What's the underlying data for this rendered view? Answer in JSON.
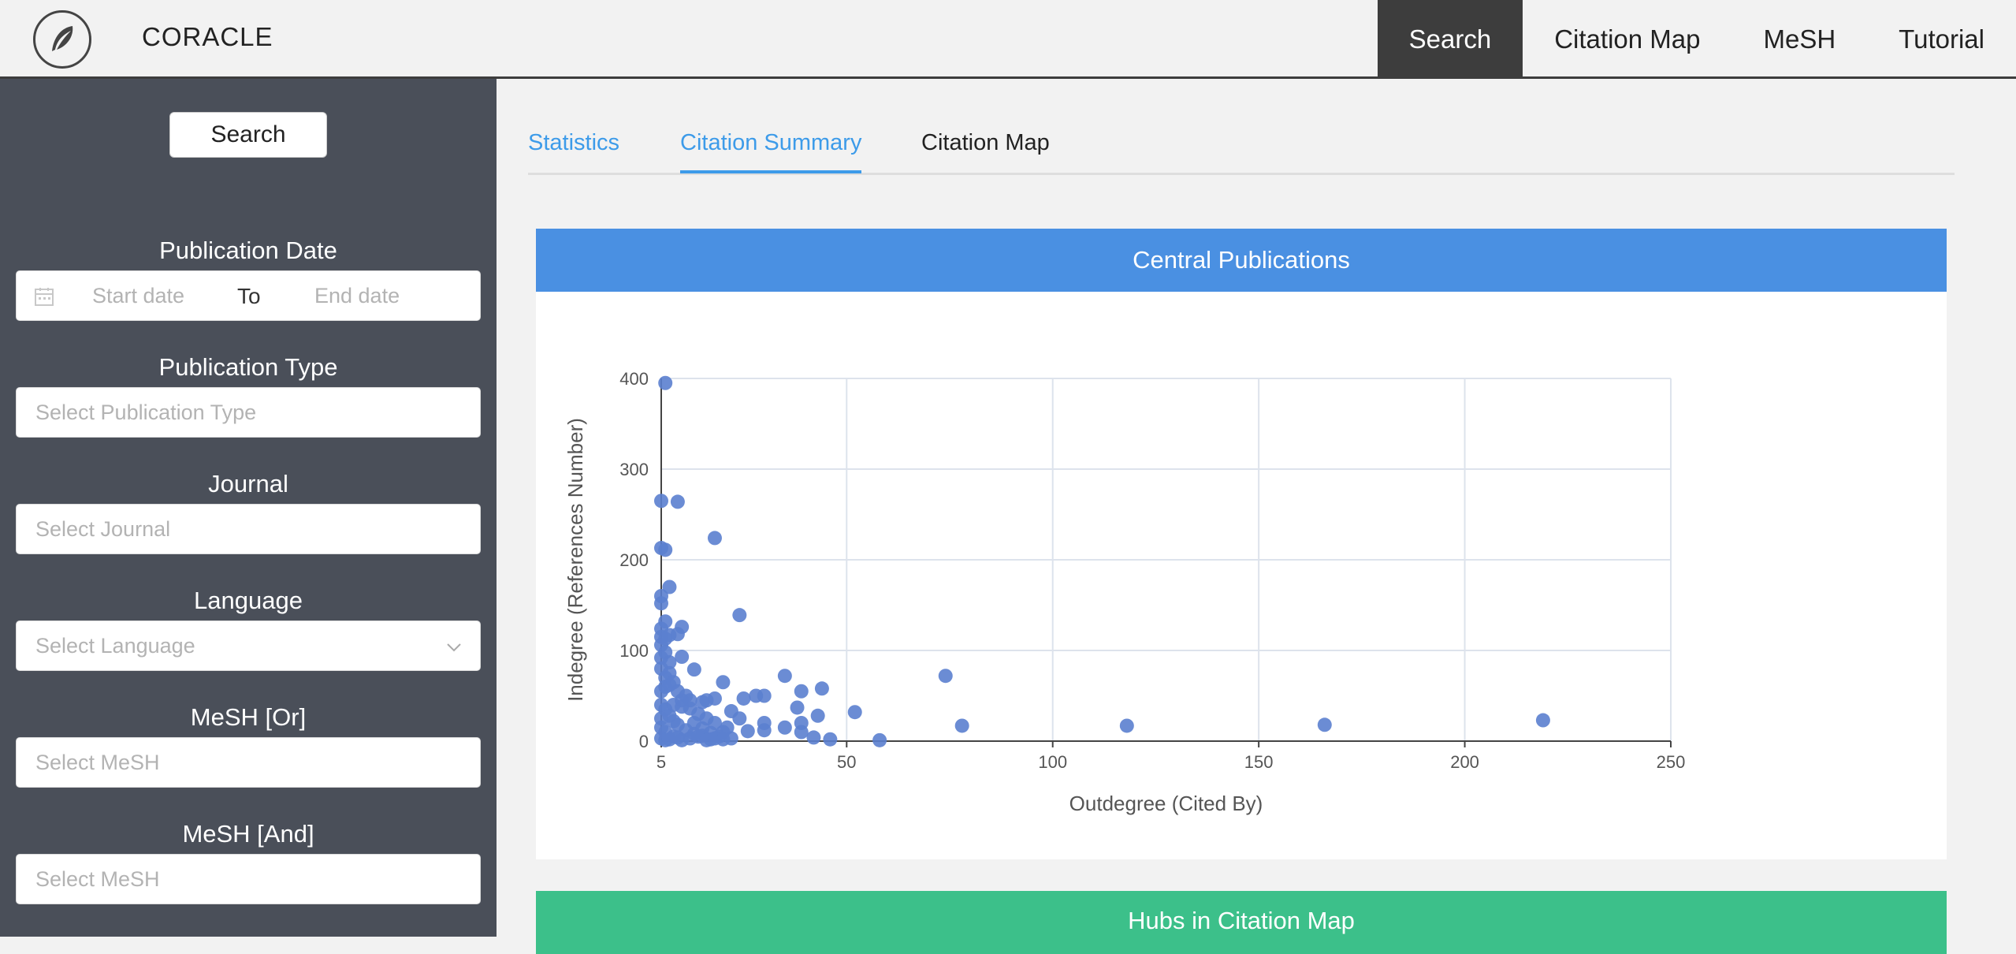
{
  "app": {
    "brand": "CORACLE"
  },
  "nav": {
    "items": [
      {
        "label": "Search",
        "active": true
      },
      {
        "label": "Citation Map",
        "active": false
      },
      {
        "label": "MeSH",
        "active": false
      },
      {
        "label": "Tutorial",
        "active": false
      }
    ]
  },
  "sidebar": {
    "search_label": "Search",
    "publication_date": {
      "label": "Publication Date",
      "start_placeholder": "Start date",
      "to": "To",
      "end_placeholder": "End date"
    },
    "publication_type": {
      "label": "Publication Type",
      "placeholder": "Select Publication Type"
    },
    "journal": {
      "label": "Journal",
      "placeholder": "Select Journal"
    },
    "language": {
      "label": "Language",
      "placeholder": "Select Language"
    },
    "mesh_or": {
      "label": "MeSH [Or]",
      "placeholder": "Select MeSH"
    },
    "mesh_and": {
      "label": "MeSH [And]",
      "placeholder": "Select MeSH"
    }
  },
  "tabs": [
    {
      "label": "Statistics"
    },
    {
      "label": "Citation Summary",
      "active": true
    },
    {
      "label": "Citation Map"
    }
  ],
  "cards": {
    "central": {
      "title": "Central Publications"
    },
    "hubs": {
      "title": "Hubs in Citation Map"
    }
  },
  "colors": {
    "accent": "#3d9be9",
    "card_header": "#4a90e2",
    "hubs_header": "#3cc08a",
    "point": "#5b7fcf",
    "sidebar": "#4a4f59"
  },
  "chart_data": {
    "type": "scatter",
    "xlabel": "Outdegree (Cited By)",
    "ylabel": "Indegree (References Number)",
    "xlim": [
      5,
      250
    ],
    "ylim": [
      0,
      400
    ],
    "xticks": [
      5,
      50,
      100,
      150,
      200,
      250
    ],
    "yticks": [
      0,
      100,
      200,
      300,
      400
    ],
    "grid": true,
    "points": [
      [
        6,
        395
      ],
      [
        5,
        265
      ],
      [
        9,
        264
      ],
      [
        5,
        213
      ],
      [
        6,
        211
      ],
      [
        18,
        224
      ],
      [
        7,
        170
      ],
      [
        5,
        160
      ],
      [
        5,
        152
      ],
      [
        24,
        139
      ],
      [
        6,
        132
      ],
      [
        10,
        126
      ],
      [
        5,
        124
      ],
      [
        9,
        118
      ],
      [
        7,
        117
      ],
      [
        5,
        115
      ],
      [
        6,
        113
      ],
      [
        5,
        106
      ],
      [
        10,
        93
      ],
      [
        6,
        98
      ],
      [
        5,
        92
      ],
      [
        7,
        87
      ],
      [
        13,
        79
      ],
      [
        74,
        72
      ],
      [
        35,
        72
      ],
      [
        20,
        65
      ],
      [
        44,
        58
      ],
      [
        39,
        55
      ],
      [
        28,
        50
      ],
      [
        30,
        50
      ],
      [
        25,
        47
      ],
      [
        18,
        47
      ],
      [
        16,
        45
      ],
      [
        15,
        43
      ],
      [
        10,
        45
      ],
      [
        8,
        40
      ],
      [
        38,
        37
      ],
      [
        52,
        32
      ],
      [
        43,
        28
      ],
      [
        12,
        36
      ],
      [
        22,
        33
      ],
      [
        24,
        25
      ],
      [
        30,
        20
      ],
      [
        39,
        20
      ],
      [
        78,
        17
      ],
      [
        118,
        17
      ],
      [
        166,
        18
      ],
      [
        219,
        23
      ],
      [
        21,
        15
      ],
      [
        35,
        15
      ],
      [
        30,
        12
      ],
      [
        26,
        11
      ],
      [
        39,
        10
      ],
      [
        42,
        4
      ],
      [
        46,
        2
      ],
      [
        58,
        1
      ],
      [
        19,
        5
      ],
      [
        17,
        2
      ],
      [
        15,
        6
      ],
      [
        13,
        8
      ],
      [
        11,
        12
      ],
      [
        9,
        18
      ],
      [
        8,
        22
      ],
      [
        7,
        28
      ],
      [
        6,
        35
      ],
      [
        5,
        40
      ],
      [
        5,
        55
      ],
      [
        6,
        60
      ],
      [
        7,
        62
      ],
      [
        9,
        55
      ],
      [
        11,
        50
      ],
      [
        12,
        45
      ],
      [
        14,
        30
      ],
      [
        16,
        25
      ],
      [
        18,
        20
      ],
      [
        20,
        10
      ],
      [
        22,
        3
      ],
      [
        8,
        5
      ],
      [
        6,
        10
      ],
      [
        5,
        15
      ],
      [
        5,
        25
      ],
      [
        6,
        70
      ],
      [
        7,
        75
      ],
      [
        5,
        80
      ],
      [
        8,
        65
      ],
      [
        10,
        38
      ],
      [
        13,
        20
      ],
      [
        15,
        14
      ],
      [
        17,
        9
      ],
      [
        5,
        3
      ],
      [
        6,
        1
      ],
      [
        7,
        2
      ],
      [
        9,
        4
      ],
      [
        10,
        1
      ],
      [
        12,
        3
      ],
      [
        14,
        5
      ],
      [
        16,
        1
      ],
      [
        18,
        3
      ],
      [
        20,
        2
      ]
    ]
  }
}
